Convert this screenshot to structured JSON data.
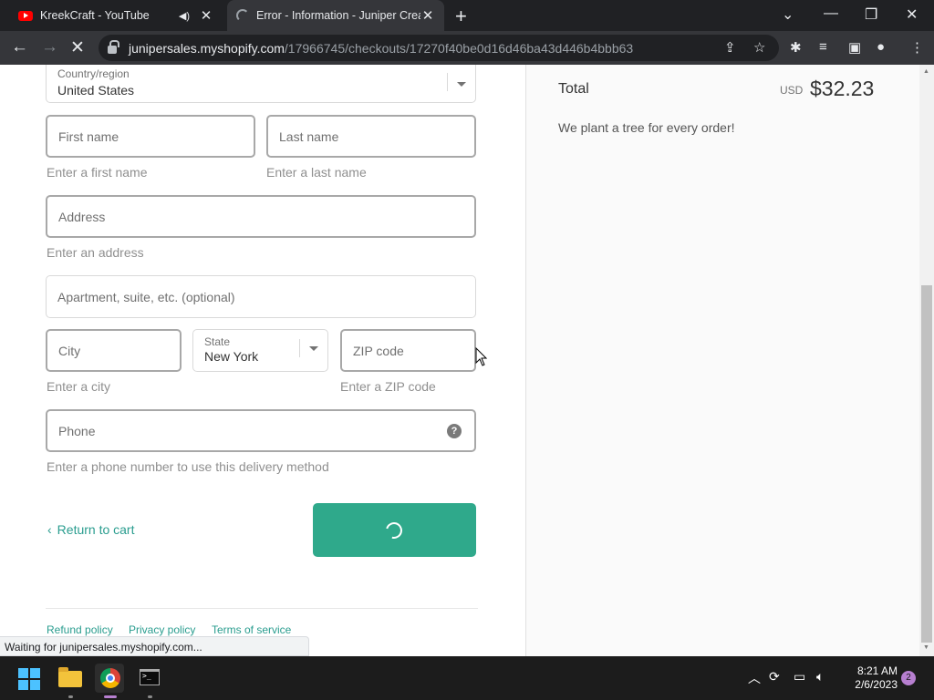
{
  "browser": {
    "tabs": [
      {
        "title": "KreekCraft - YouTube",
        "active": false,
        "audio": true
      },
      {
        "title": "Error - Information - Juniper Crea",
        "active": true,
        "loading": true
      }
    ],
    "url_host": "junipersales.myshopify.com",
    "url_path": "/17966745/checkouts/17270f40be0d16d46ba43d446b4bbb63",
    "status_text": "Waiting for junipersales.myshopify.com..."
  },
  "form": {
    "country_label": "Country/region",
    "country_value": "United States",
    "first_name_placeholder": "First name",
    "first_name_error": "Enter a first name",
    "last_name_placeholder": "Last name",
    "last_name_error": "Enter a last name",
    "address_placeholder": "Address",
    "address_error": "Enter an address",
    "apartment_placeholder": "Apartment, suite, etc. (optional)",
    "city_placeholder": "City",
    "city_error": "Enter a city",
    "state_label": "State",
    "state_value": "New York",
    "zip_placeholder": "ZIP code",
    "zip_error": "Enter a ZIP code",
    "phone_placeholder": "Phone",
    "phone_help": "?",
    "phone_error": "Enter a phone number to use this delivery method",
    "return_link": "Return to cart"
  },
  "footer": {
    "links": [
      "Refund policy",
      "Privacy policy",
      "Terms of service"
    ]
  },
  "summary": {
    "total_label": "Total",
    "currency": "USD",
    "amount": "$32.23",
    "tree_message": "We plant a tree for every order!"
  },
  "taskbar": {
    "time": "8:21 AM",
    "date": "2/6/2023",
    "notifications": "2"
  },
  "colors": {
    "accent": "#2fa98b",
    "link": "#2a9d8f",
    "chrome_dark": "#202124"
  }
}
